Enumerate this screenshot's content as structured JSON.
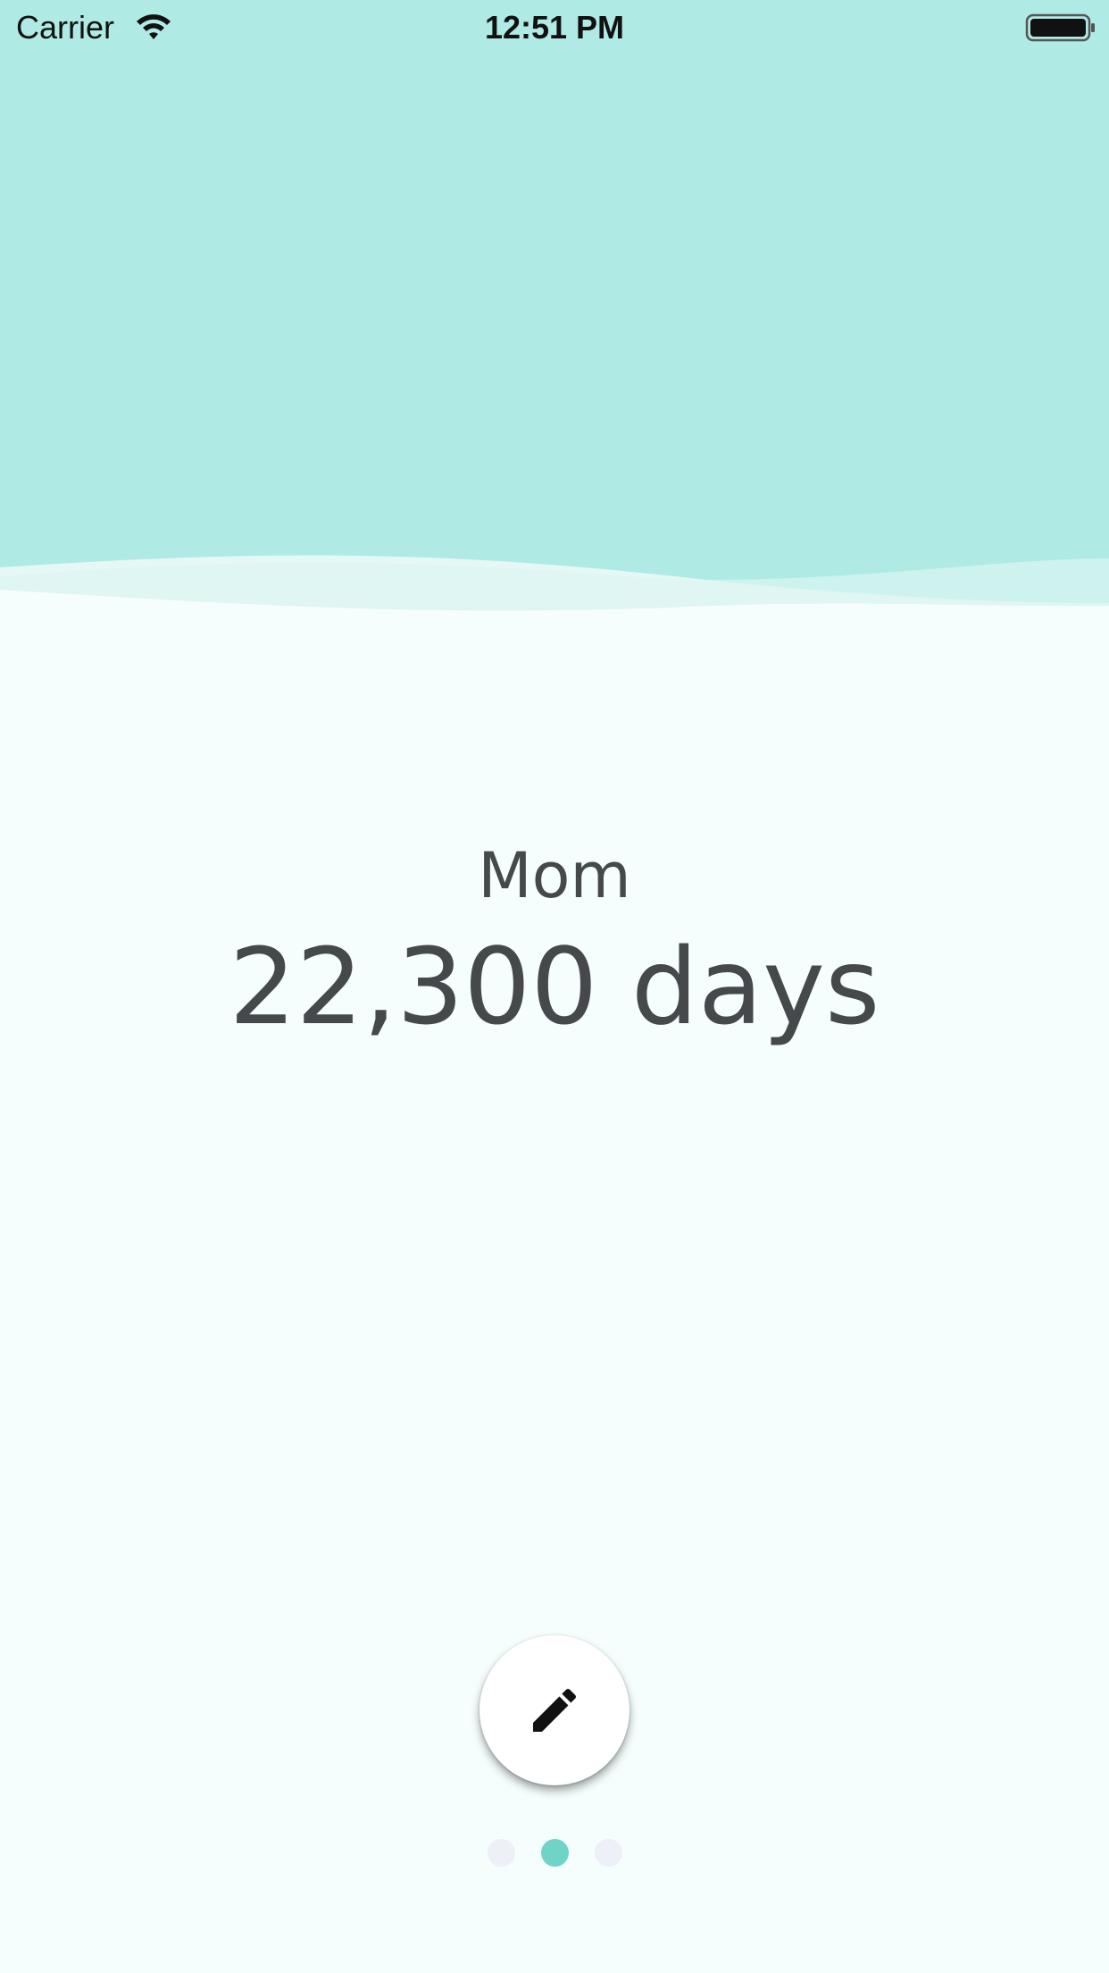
{
  "status_bar": {
    "carrier": "Carrier",
    "time": "12:51 PM",
    "icons": [
      "wifi-icon",
      "battery-icon"
    ]
  },
  "main": {
    "name": "Mom",
    "count": "22,300 days"
  },
  "fab": {
    "icon": "pencil-icon"
  },
  "pager": {
    "total": 3,
    "active_index": 1
  },
  "colors": {
    "top_band": "#afebe4",
    "background": "#f5fdfd",
    "text": "#45494b",
    "active_dot": "#6fd3c8",
    "inactive_dot": "#eef0f8"
  }
}
